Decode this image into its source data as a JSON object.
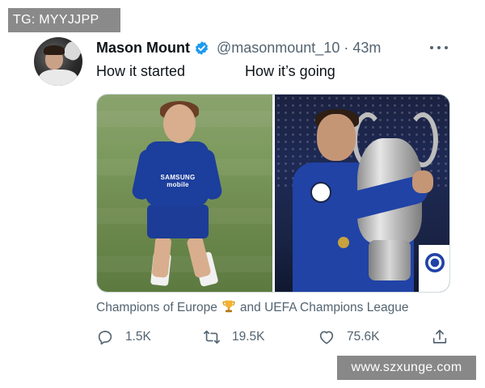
{
  "watermark_top": {
    "text": "TG: MYYJJPP"
  },
  "tweet": {
    "author": {
      "name": "Mason Mount",
      "handle": "@masonmount_10",
      "separator": "·",
      "time": "43m",
      "verified_color": "#1d9bf0"
    },
    "text": {
      "left": "How it started",
      "right": "How it’s going"
    },
    "caption": {
      "before": "Champions of Europe",
      "emoji": "trophy-emoji",
      "after": "and UEFA Champions League"
    },
    "actions": {
      "reply_count": "1.5K",
      "retweet_count": "19.5K",
      "like_count": "75.6K"
    },
    "media": {
      "left_image_text": "SAMSUNG mobile"
    }
  },
  "watermark_bottom": {
    "text": "www.szxunge.com"
  },
  "colors": {
    "text_primary": "#0f1419",
    "text_secondary": "#536471",
    "accent_blue": "#1d9bf0",
    "watermark_bg": "#8a8a8a"
  }
}
